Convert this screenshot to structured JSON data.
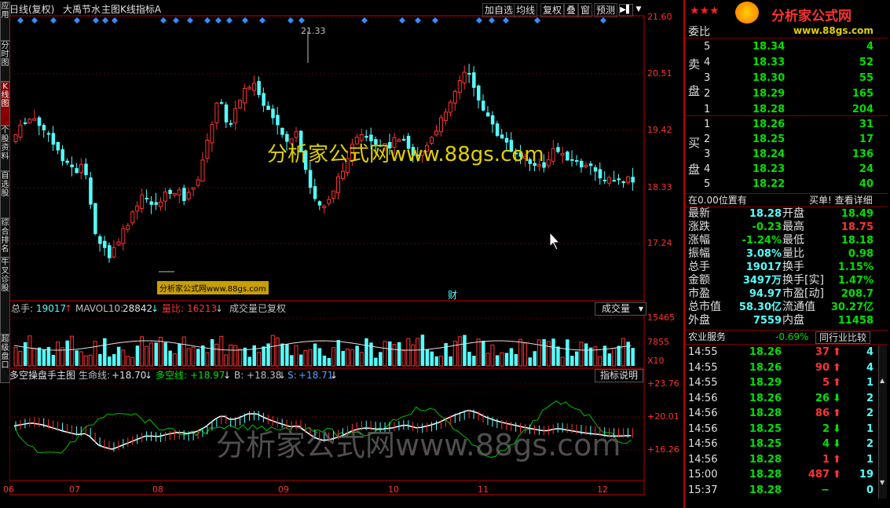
{
  "window": {
    "title": "日线(复权)",
    "stock": "大禹节水",
    "indicator": "主图K线指标A"
  },
  "toolbar": {
    "buttons": [
      "加自选",
      "均线",
      "复权",
      "叠",
      "窗",
      "预测"
    ]
  },
  "left_tabs": [
    "应用",
    "分时图",
    "K线图",
    "个股资料",
    "自选股",
    "综合排名",
    "牛叉诊股",
    "超级盘口"
  ],
  "price_axis": [
    "21.60",
    "20.51",
    "19.42",
    "18.33",
    "17.24"
  ],
  "max_label": "21.33",
  "watermark": "分析家公式网www.88gs.com",
  "watermark2": "分析家公式网www.88gs.com",
  "small_tag": "分析家公式网www.88gs.com",
  "cai_label": "财",
  "volume_header": {
    "a_label": "总手:",
    "a_val": "19017",
    "b_label": "MAVOL10:",
    "b_val": "28842",
    "c_label": "量比:",
    "c_val": "16213",
    "d": "成交量已复权",
    "dropdown": "成交量"
  },
  "volume_axis": [
    "15465",
    "7855",
    "X10"
  ],
  "ind_header": {
    "name": "多空操盘手主图",
    "a_label": "生命线:",
    "a_val": "+18.70",
    "b_label": "多空线:",
    "b_val": "+18.97",
    "c_label": "B:",
    "c_val": "+18.38",
    "d_label": "S:",
    "d_val": "+18.71",
    "btn": "指标说明"
  },
  "ind_axis": [
    "+23.76",
    "+20.01",
    "+16.26"
  ],
  "months": [
    "06",
    "07",
    "08",
    "09",
    "10",
    "11",
    "12"
  ],
  "logo": {
    "stars": "★★★",
    "name": "分析家公式网",
    "url": "www.88gs.com"
  },
  "order_book": {
    "weibi_label": "委比",
    "sell_label": [
      "卖",
      "盘"
    ],
    "buy_label": [
      "买",
      "盘"
    ],
    "sell": [
      [
        "5",
        "18.34",
        "4"
      ],
      [
        "4",
        "18.33",
        "52"
      ],
      [
        "3",
        "18.30",
        "55"
      ],
      [
        "2",
        "18.29",
        "165"
      ],
      [
        "1",
        "18.28",
        "204"
      ]
    ],
    "buy": [
      [
        "1",
        "18.26",
        "31"
      ],
      [
        "2",
        "18.25",
        "17"
      ],
      [
        "3",
        "18.24",
        "136"
      ],
      [
        "4",
        "18.23",
        "24"
      ],
      [
        "5",
        "18.22",
        "40"
      ]
    ]
  },
  "status_line": {
    "left": "在0.00位置有",
    "right": "买单! 查看详细"
  },
  "stats": [
    [
      "最新",
      "18.28",
      "开盘",
      "18.49"
    ],
    [
      "涨跌",
      "-0.23",
      "最高",
      "18.75"
    ],
    [
      "涨幅",
      "-1.24%",
      "最低",
      "18.18"
    ],
    [
      "振幅",
      "3.08%",
      "量比",
      "0.98"
    ],
    [
      "总手",
      "19017",
      "换手",
      "1.15%"
    ],
    [
      "金额",
      "3497万",
      "换手[实]",
      "1.47%"
    ],
    [
      "市盈",
      "94.97",
      "市盈[动]",
      "208.7"
    ],
    [
      "总市值",
      "58.30亿",
      "流通值",
      "30.27亿"
    ],
    [
      "外盘",
      "7559",
      "内盘",
      "11458"
    ]
  ],
  "sector": {
    "name": "农业服务",
    "change": "-0.69%",
    "btn": "同行业比较"
  },
  "ticks": [
    [
      "14:55",
      "18.26",
      "37",
      "up",
      "4"
    ],
    [
      "14:55",
      "18.26",
      "90",
      "up",
      "4"
    ],
    [
      "14:55",
      "18.29",
      "5",
      "up",
      "1"
    ],
    [
      "14:56",
      "18.26",
      "26",
      "down",
      "2"
    ],
    [
      "14:56",
      "18.28",
      "86",
      "up",
      "2"
    ],
    [
      "14:56",
      "18.25",
      "2",
      "down",
      "1"
    ],
    [
      "14:56",
      "18.25",
      "4",
      "down",
      "2"
    ],
    [
      "14:56",
      "18.28",
      "1",
      "up",
      "1"
    ],
    [
      "15:00",
      "18.28",
      "487",
      "up",
      "19"
    ],
    [
      "15:37",
      "18.28",
      "−",
      "none",
      "0"
    ]
  ],
  "colors": {
    "up": "#ff3232",
    "down": "#54ffff",
    "text": "#c0c0c0",
    "yellow": "#ffff00",
    "green": "#00e000"
  }
}
